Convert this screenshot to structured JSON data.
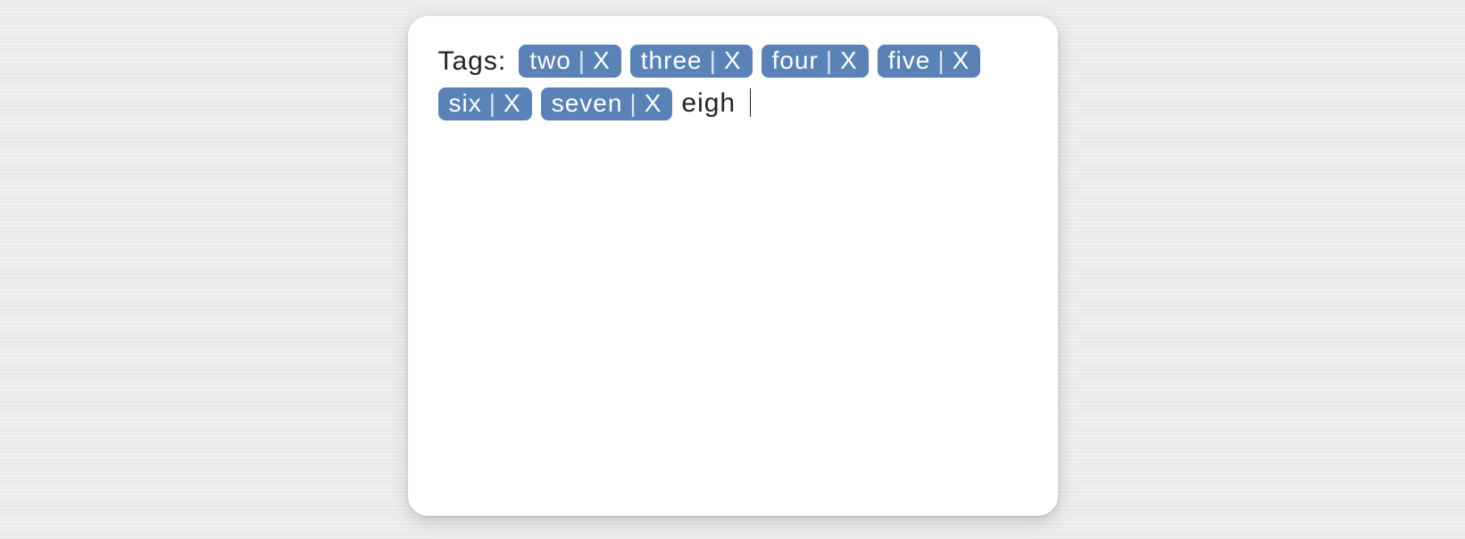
{
  "label": "Tags:",
  "separator": "|",
  "close_glyph": "X",
  "tags": [
    {
      "text": "two"
    },
    {
      "text": "three"
    },
    {
      "text": "four"
    },
    {
      "text": "five"
    },
    {
      "text": "six"
    },
    {
      "text": "seven"
    }
  ],
  "input_value": "eigh",
  "colors": {
    "tag_bg": "#5a82b6",
    "tag_fg": "#ffffff"
  }
}
